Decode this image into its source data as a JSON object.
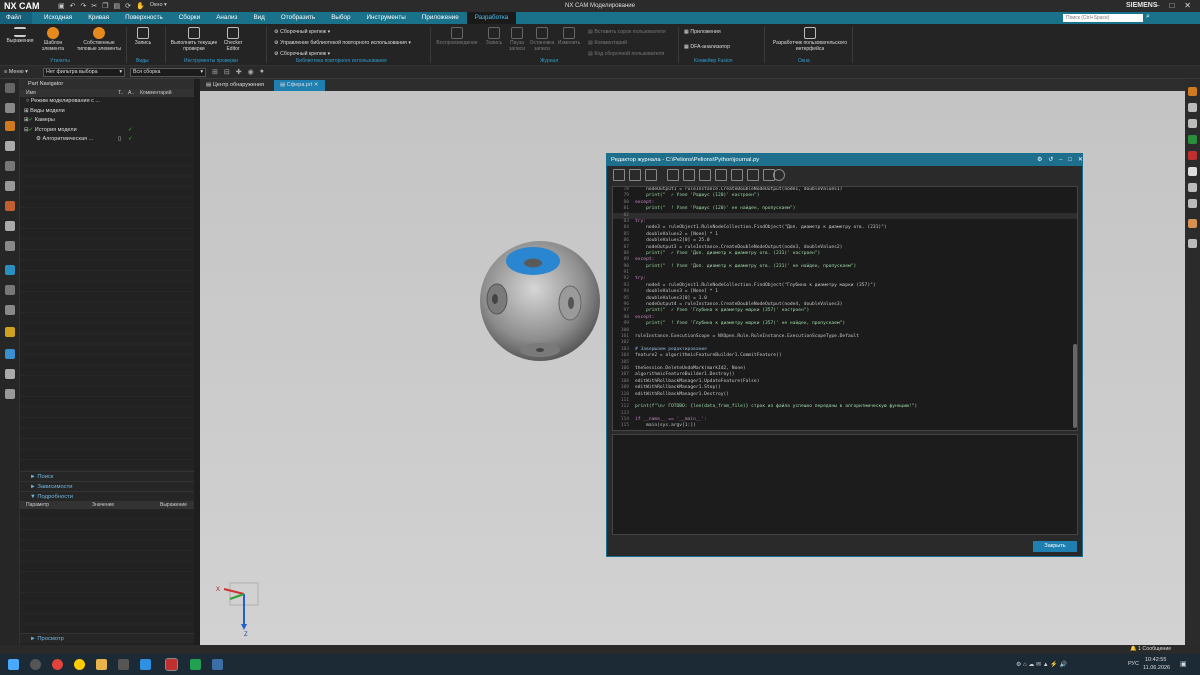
{
  "app": {
    "logo": "NX CAM",
    "window_title": "NX CAM Моделирование",
    "brand": "SIEMENS",
    "window_menu": "Окно"
  },
  "menu_tabs": [
    "Файл",
    "Исходная",
    "Кривая",
    "Поверхность",
    "Сборки",
    "Анализ",
    "Вид",
    "Отобразить",
    "Выбор",
    "Инструменты",
    "Приложение",
    "Разработка"
  ],
  "active_tab": "Разработка",
  "search": {
    "placeholder": "Поиск (Ctrl+Space)"
  },
  "ribbon": {
    "b_express": "Выражения",
    "b_template": "Шаблон элемента",
    "b_custom": "Собственные типовые элементы",
    "g_utilities": "Утилиты",
    "b_record": "Запись",
    "g_view": "Виды",
    "b_run_check": "Выполнить текущие проверки",
    "b_checker": "Checker Editor",
    "g_check": "Инструменты проверки",
    "l_assembly_fastener": "Сборочный крепеж",
    "l_library_mgmt": "Управление библиотекой повторного использования",
    "l_assembly_fastener2": "Сборочный крепеж",
    "g_library": "Библиотека повторного использования",
    "b_play": "Воспроизведение",
    "b_rec": "Запись",
    "b_pause": "Пауза записи",
    "b_stop": "Остановка записи",
    "b_edit": "Изменить",
    "l_insert_user": "Вставить сорок пользователя",
    "l_comment": "Комментарий",
    "l_code": "Код сборочной пользователя",
    "g_journal": "Журнал",
    "b_apps": "Приложения",
    "b_dfa": "DFA-анализатор",
    "g_knowledge": "Конвейер Fusion",
    "b_designer": "Разработчик пользовательского интерфейса",
    "g_dialog": "Окна"
  },
  "toolbar": {
    "menu_label": "Меню",
    "filter_value": "Нет фильтра выбора",
    "scope_value": "Вся сборка"
  },
  "navigator": {
    "title": "Part Navigator",
    "col_name": "Имя",
    "col_t": "Т..",
    "col_a": "А..",
    "col_comment": "Комментарий",
    "items": [
      "Режим моделирования с ...",
      "Виды модели",
      "Камеры",
      "История модели",
      "Алгоритмическая ..."
    ],
    "sections": {
      "search": "Поиск",
      "deps": "Зависимости",
      "details": "Подробности",
      "preview": "Просмотр"
    },
    "detail_cols": [
      "Параметр",
      "Значение",
      "Выражение"
    ]
  },
  "doc_tabs": [
    "Центр обнаружения",
    "Сфера.prt"
  ],
  "journal": {
    "title": "Редактор журнала - C:\\Pelions\\Pelions\\Python\\journal.py",
    "close_label": "Закрыть",
    "lines": [
      {
        "n": "78",
        "t": "    nodeOutput1 = ruleInstance.CreateDoubleNodeOutput(node1, doubleValues1)"
      },
      {
        "n": "79",
        "t": "    print(\"  ✓ Узел 'Радиус (120)' настроен\")"
      },
      {
        "n": "80",
        "t": "except:"
      },
      {
        "n": "81",
        "t": "    print(\"  ! Узел 'Радиус (120)' не найден, пропускаем\")"
      },
      {
        "n": "82",
        "t": ""
      },
      {
        "n": "83",
        "t": "try:"
      },
      {
        "n": "84",
        "t": "    node3 = ruleObject1.RuleNodeCollection.FindObject(\"Доп. диаметр к диаметру отв. (231)\")"
      },
      {
        "n": "85",
        "t": "    doubleValues2 = [None] * 1"
      },
      {
        "n": "86",
        "t": "    doubleValues2[0] = 25.0"
      },
      {
        "n": "87",
        "t": "    nodeOutput3 = ruleInstance.CreateDoubleNodeOutput(node3, doubleValues2)"
      },
      {
        "n": "88",
        "t": "    print(\"  ✓ Узел 'Доп. диаметр к диаметру отв. (231)' настроен\")"
      },
      {
        "n": "89",
        "t": "except:"
      },
      {
        "n": "90",
        "t": "    print(\"  ! Узел 'Доп. диаметр к диаметру отв. (231)' не найден, пропускаем\")"
      },
      {
        "n": "91",
        "t": ""
      },
      {
        "n": "92",
        "t": "try:"
      },
      {
        "n": "93",
        "t": "    node4 = ruleObject1.RuleNodeCollection.FindObject(\"Глубина к диаметру марки (357)\")"
      },
      {
        "n": "94",
        "t": "    doubleValues3 = [None] * 1"
      },
      {
        "n": "95",
        "t": "    doubleValues3[0] = 1.0"
      },
      {
        "n": "96",
        "t": "    nodeOutput4 = ruleInstance.CreateDoubleNodeOutput(node4, doubleValues3)"
      },
      {
        "n": "97",
        "t": "    print(\"  ✓ Узел 'Глубина к диаметру марки (357)' настроен\")"
      },
      {
        "n": "98",
        "t": "except:"
      },
      {
        "n": "99",
        "t": "    print(\"  ! Узел 'Глубина к диаметру марки (357)' не найден, пропускаем\")"
      },
      {
        "n": "100",
        "t": ""
      },
      {
        "n": "101",
        "t": "ruleInstance.ExecutionScope = NXOpen.Rule.RuleInstance.ExecutionScopeType.Default"
      },
      {
        "n": "102",
        "t": ""
      },
      {
        "n": "103",
        "t": "# Завершаем редактирование"
      },
      {
        "n": "104",
        "t": "feature2 = algorithmicFeatureBuilder1.CommitFeature()"
      },
      {
        "n": "105",
        "t": ""
      },
      {
        "n": "106",
        "t": "theSession.DeleteUndoMark(markId2, None)"
      },
      {
        "n": "107",
        "t": "algorithmicFeatureBuilder1.Destroy()"
      },
      {
        "n": "108",
        "t": "editWithRollbackManager1.UpdateFeature(False)"
      },
      {
        "n": "109",
        "t": "editWithRollbackManager1.Stop()"
      },
      {
        "n": "110",
        "t": "editWithRollbackManager1.Destroy()"
      },
      {
        "n": "111",
        "t": ""
      },
      {
        "n": "112",
        "t": "print(f\"\\n✓ ГОТОВО: {len(data_from_file)} строк из файла успешно переданы в алгоритмическую функцию!\")"
      },
      {
        "n": "113",
        "t": ""
      },
      {
        "n": "114",
        "t": "if __name__ == '__main__':"
      },
      {
        "n": "115",
        "t": "    main(sys.argv[1:])"
      }
    ]
  },
  "statusbar": {
    "message": "1 Сообщение"
  },
  "taskbar": {
    "time": "10:42:55",
    "date": "11.06.2026",
    "lang": "РУС"
  },
  "colors": {
    "accent": "#19718a",
    "tab_active": "#4cc3f0",
    "dialog_title": "#1e6f8c",
    "button": "#1f7fb0"
  }
}
